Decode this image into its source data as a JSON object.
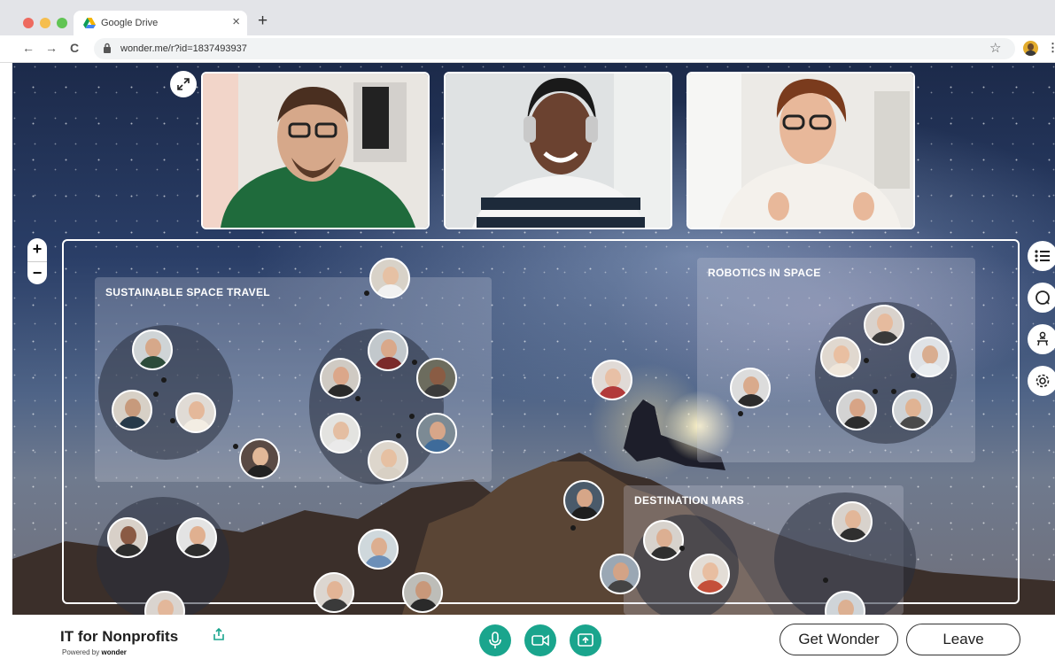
{
  "browser": {
    "tab_title": "Google Drive",
    "tab_close": "×",
    "new_tab": "+",
    "url": "wonder.me/r?id=1837493937",
    "back": "←",
    "forward": "→",
    "reload": "C",
    "star": "☆",
    "menu": "⋮"
  },
  "map": {
    "zoom_in": "+",
    "zoom_out": "−",
    "areas": [
      {
        "title": "SUSTAINABLE SPACE TRAVEL"
      },
      {
        "title": "ROBOTICS IN SPACE"
      },
      {
        "title": "DESTINATION MARS"
      }
    ]
  },
  "sidebar": [
    "list-icon",
    "chat-icon",
    "people-icon",
    "gear-icon"
  ],
  "footer": {
    "room_name": "IT for Nonprofits",
    "powered_prefix": "Powered by ",
    "powered_brand": "wonder",
    "get_wonder": "Get Wonder",
    "leave": "Leave",
    "controls": [
      "microphone-icon",
      "camera-icon",
      "screen-share-icon"
    ]
  },
  "colors": {
    "accent": "#1aa58d",
    "frame": "#ffffff"
  }
}
